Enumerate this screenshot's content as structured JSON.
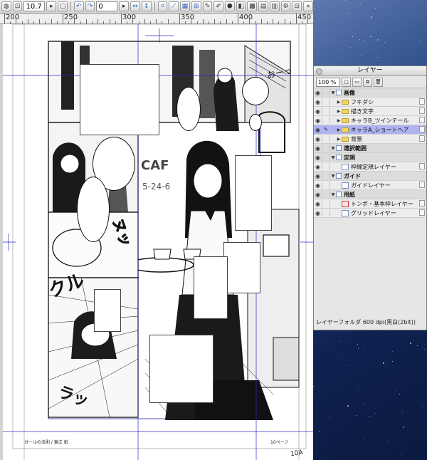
{
  "toolbar": {
    "zoom_value": "10.7",
    "angle_value": "0",
    "accent": "#2a62c4"
  },
  "ruler": {
    "labels": [
      "200",
      "250",
      "300",
      "350",
      "400",
      "450"
    ]
  },
  "layer_panel": {
    "title": "レイヤー",
    "zoom": "100 %",
    "rows": [
      {
        "label": "画像",
        "kind": "section",
        "expanded": true
      },
      {
        "label": "フキダシ",
        "kind": "folder"
      },
      {
        "label": "描き文字",
        "kind": "folder"
      },
      {
        "label": "キャラB_ツインテール",
        "kind": "folder"
      },
      {
        "label": "キャラA_ショートヘア",
        "kind": "folder",
        "selected": true
      },
      {
        "label": "背景",
        "kind": "folder"
      },
      {
        "label": "選択範囲",
        "kind": "section"
      },
      {
        "label": "定規",
        "kind": "section"
      },
      {
        "label": "枠線定規レイヤー",
        "kind": "layer"
      },
      {
        "label": "ガイド",
        "kind": "section"
      },
      {
        "label": "ガイドレイヤー",
        "kind": "layer"
      },
      {
        "label": "用紙",
        "kind": "section"
      },
      {
        "label": "トンボ・基本枠レイヤー",
        "kind": "layer-red"
      },
      {
        "label": "グリッドレイヤー",
        "kind": "layer"
      }
    ],
    "status": "レイヤーフォルダ 600 dpi(黒白(2bit))",
    "selected_color": "#aeb4f0"
  },
  "canvas": {
    "sfx": [
      "おーっ",
      "ヌッ",
      "クル",
      "ラッ",
      "CAF",
      "5-24-6"
    ],
    "footer_left": "ガールの法則 / 東江 紙",
    "footer_right": "10ページ",
    "page_number": "10A",
    "guide_color": "#2a2ac8"
  }
}
